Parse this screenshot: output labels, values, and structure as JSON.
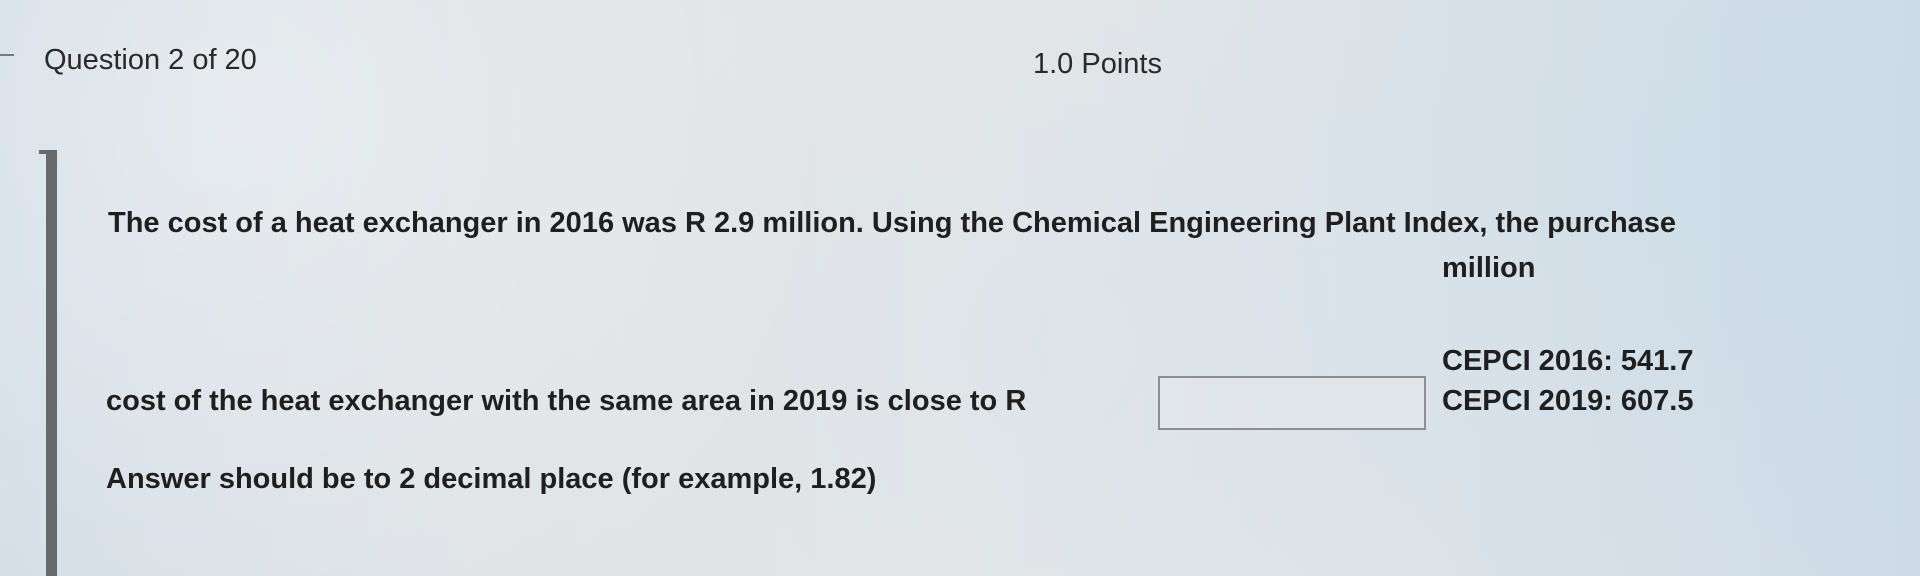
{
  "header": {
    "question_counter": "Question 2 of 20",
    "points": "1.0 Points"
  },
  "question": {
    "line1": "The cost of a heat exchanger in 2016 was R 2.9 million. Using the Chemical Engineering Plant Index, the purchase",
    "line1_end": "million",
    "line2": "cost of the heat exchanger with the same area in 2019 is close to R",
    "instruction": "Answer should be to 2 decimal place (for example, 1.82)"
  },
  "answer_input": {
    "value": "",
    "placeholder": ""
  },
  "cepci": {
    "y2016": "CEPCI 2016: 541.7",
    "y2019": "CEPCI 2019: 607.5"
  }
}
